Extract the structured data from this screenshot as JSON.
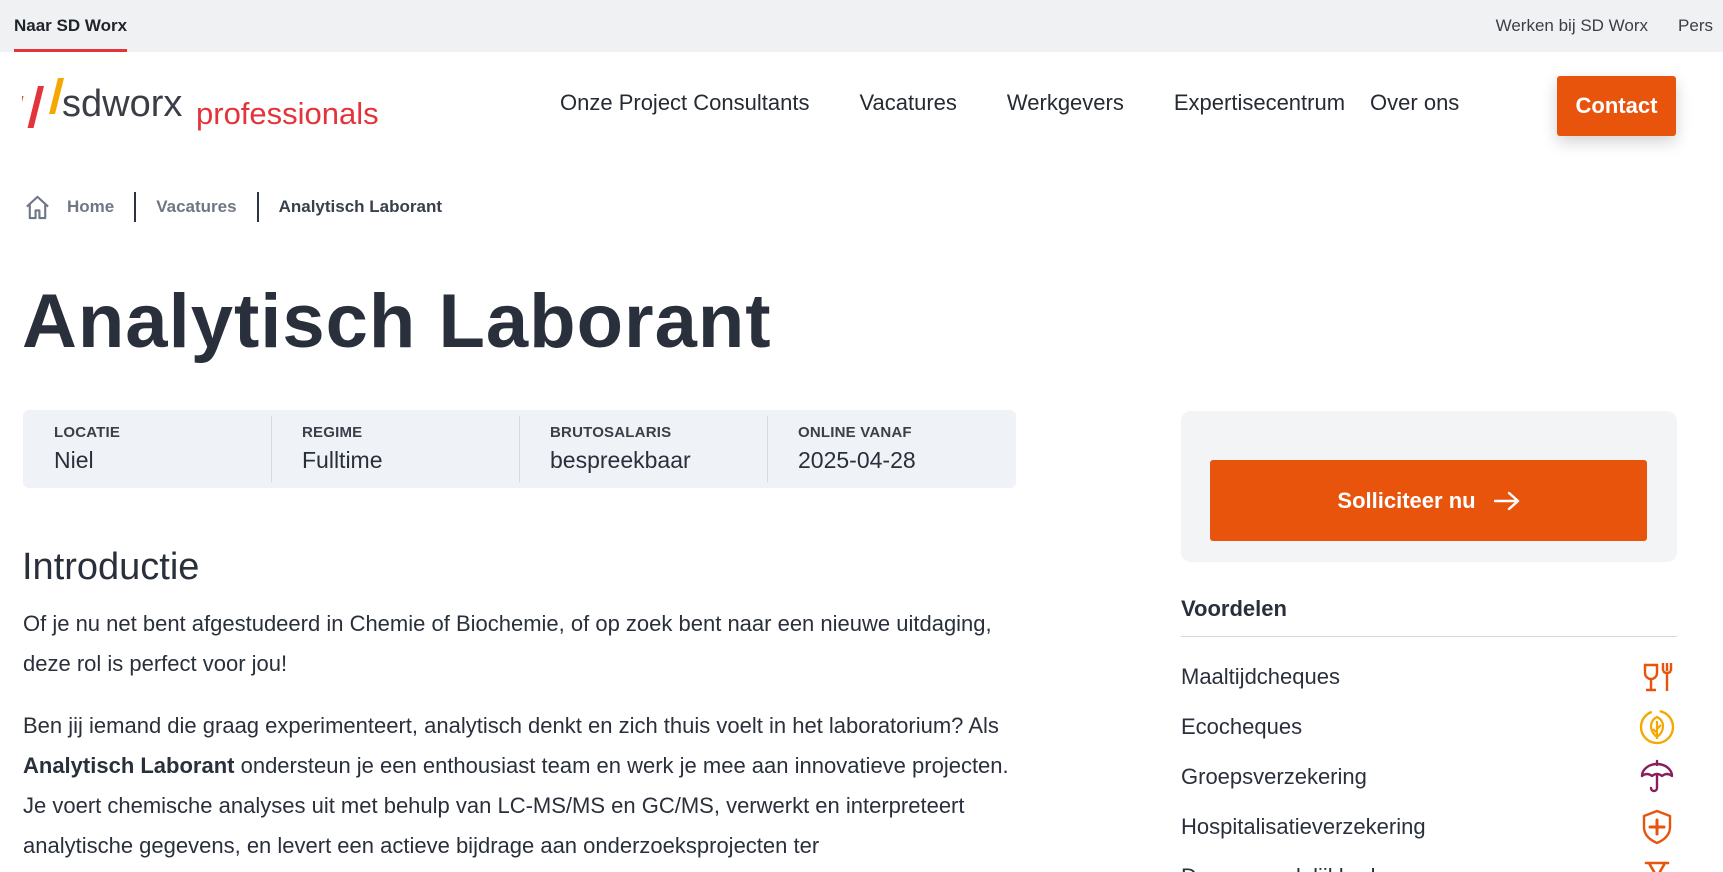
{
  "topbar": {
    "brand_link": "Naar SD Worx",
    "links": [
      "Werken bij SD Worx",
      "Pers"
    ]
  },
  "header": {
    "logo_text_main": "sdworx",
    "logo_text_sub": "professionals",
    "nav": [
      "Onze Project Consultants",
      "Vacatures",
      "Werkgevers",
      "Expertisecentrum",
      "Over ons"
    ],
    "contact_label": "Contact"
  },
  "breadcrumb": {
    "items": [
      "Home",
      "Vacatures",
      "Analytisch Laborant"
    ]
  },
  "page": {
    "title": "Analytisch Laborant"
  },
  "info": [
    {
      "label": "LOCATIE",
      "value": "Niel"
    },
    {
      "label": "REGIME",
      "value": "Fulltime"
    },
    {
      "label": "BRUTOSALARIS",
      "value": "bespreekbaar"
    },
    {
      "label": "ONLINE VANAF",
      "value": "2025-04-28"
    }
  ],
  "content": {
    "intro_heading": "Introductie",
    "para1": "Of je nu net bent afgestudeerd in Chemie of Biochemie, of op zoek bent naar een nieuwe uitdaging, deze rol is perfect voor jou!",
    "para2_before": "Ben jij iemand die graag experimenteert, analytisch denkt en zich thuis voelt in het laboratorium? Als ",
    "para2_bold": "Analytisch Laborant",
    "para2_after": " ondersteun je een enthousiast team en werk je mee aan innovatieve projecten. Je voert chemische analyses uit met behulp van LC-MS/MS en GC/MS, verwerkt en interpreteert analytische gegevens, en levert een actieve bijdrage aan onderzoeksprojecten ter"
  },
  "sidebar": {
    "apply_label": "Solliciteer nu",
    "voordelen_title": "Voordelen",
    "benefits": [
      {
        "label": "Maaltijdcheques",
        "icon": "meal-icon",
        "color": "#e9540d"
      },
      {
        "label": "Ecocheques",
        "icon": "eco-leaf-icon",
        "color": "#f5a800"
      },
      {
        "label": "Groepsverzekering",
        "icon": "umbrella-icon",
        "color": "#8a1d5e"
      },
      {
        "label": "Hospitalisatieverzekering",
        "icon": "medical-shield-icon",
        "color": "#e9540d"
      },
      {
        "label": "Dagvergoedelijkheden",
        "icon": "hourglass-icon",
        "color": "#e9540d"
      }
    ]
  },
  "colors": {
    "accent": "#e9540d",
    "brand_red": "#e3343b",
    "info_bg": "#eff2f6"
  }
}
